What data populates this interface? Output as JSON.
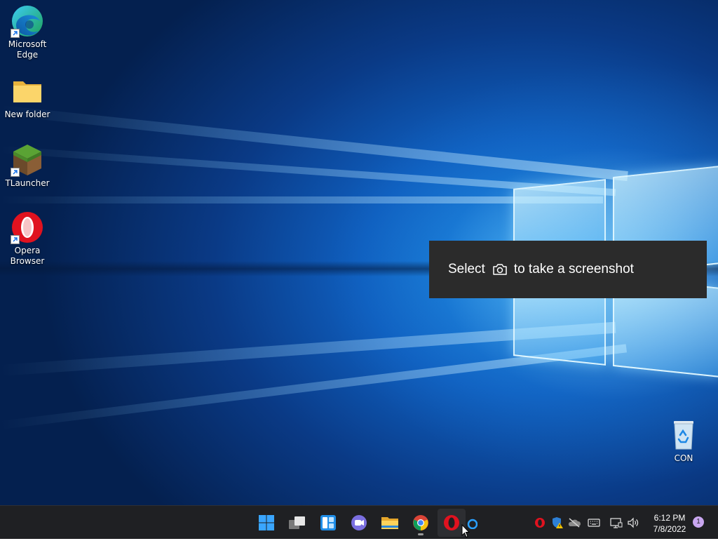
{
  "desktop_icons": [
    {
      "id": "edge",
      "label": "Microsoft Edge",
      "label_line1": "Microsoft",
      "label_line2": "Edge",
      "icon": "edge-icon"
    },
    {
      "id": "folder",
      "label": "New folder",
      "icon": "folder-icon"
    },
    {
      "id": "tlauncher",
      "label": "TLauncher",
      "icon": "tlauncher-icon"
    },
    {
      "id": "opera",
      "label": "Opera Browser",
      "label_line1": "Opera",
      "label_line2": "Browser",
      "icon": "opera-icon"
    },
    {
      "id": "recycle",
      "label": "CON",
      "icon": "recycle-bin-icon"
    }
  ],
  "toast": {
    "prefix": "Select",
    "icon": "camera-icon",
    "suffix": "to take a screenshot"
  },
  "taskbar": {
    "apps": [
      "start-icon",
      "task-view-icon",
      "widgets-icon",
      "chat-icon",
      "file-explorer-icon",
      "chrome-icon",
      "opera-icon",
      "cortana-icon"
    ],
    "clock": {
      "time": "6:12 PM",
      "date": "7/8/2022"
    },
    "notification_count": "1"
  },
  "colors": {
    "taskbar_bg": "#1f2023",
    "toast_bg": "#2b2b2b",
    "accent": "#0078d4",
    "opera_red": "#e0121f"
  }
}
